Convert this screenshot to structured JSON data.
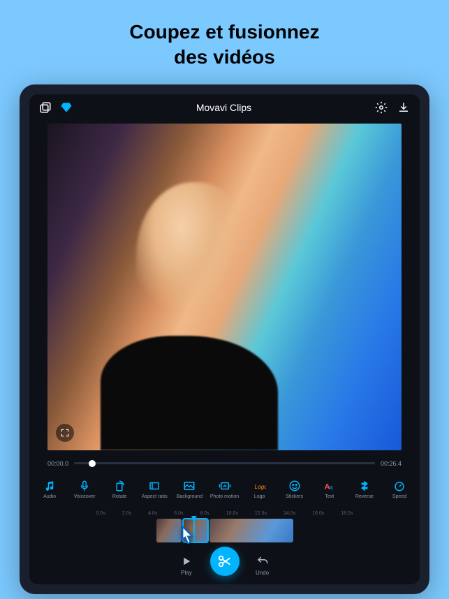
{
  "promo": {
    "line1": "Coupez et fusionnez",
    "line2": "des vidéos"
  },
  "topbar": {
    "title": "Movavi Clips"
  },
  "timeline": {
    "start": "00:00.0",
    "end": "00:26.4"
  },
  "tools": [
    {
      "key": "audio",
      "label": "Audio"
    },
    {
      "key": "voiceover",
      "label": "Voiceover"
    },
    {
      "key": "rotate",
      "label": "Rotate"
    },
    {
      "key": "aspect",
      "label": "Aspect ratio"
    },
    {
      "key": "background",
      "label": "Background"
    },
    {
      "key": "photomotion",
      "label": "Photo motion"
    },
    {
      "key": "logo",
      "label": "Logo"
    },
    {
      "key": "stickers",
      "label": "Stickers"
    },
    {
      "key": "text",
      "label": "Text"
    },
    {
      "key": "reverse",
      "label": "Reverse"
    },
    {
      "key": "speed",
      "label": "Speed"
    }
  ],
  "ruler": [
    "0.0s",
    "2.0s",
    "4.0s",
    "6.0s",
    "8.0s",
    "10.0s",
    "12.0s",
    "14.0s",
    "16.0s",
    "18.0s"
  ],
  "controls": {
    "play": "Play",
    "undo": "Undo"
  }
}
